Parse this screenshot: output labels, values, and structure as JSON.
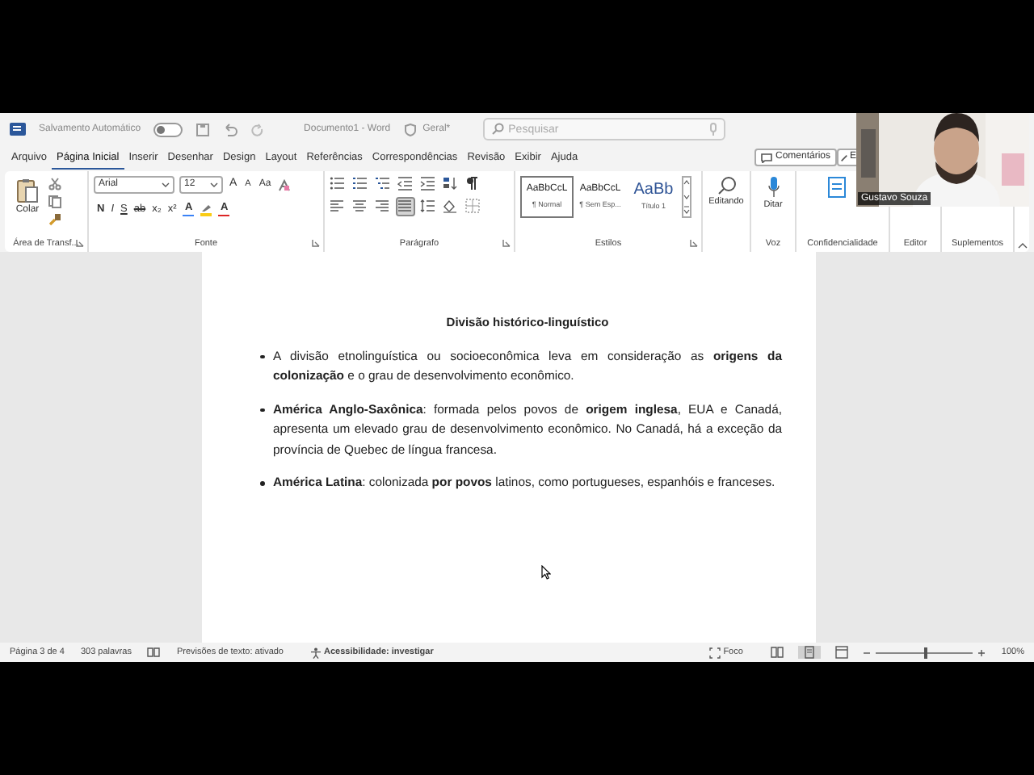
{
  "title_bar": {
    "autosave_label": "Salvamento Automático",
    "autosave_on": false,
    "document_title": "Documento1 - Word",
    "sensitivity": "Geral*",
    "search": {
      "placeholder": "Pesquisar"
    }
  },
  "menu_tabs": [
    {
      "label": "Arquivo",
      "selected": false
    },
    {
      "label": "Página Inicial",
      "selected": true
    },
    {
      "label": "Inserir",
      "selected": false
    },
    {
      "label": "Desenhar",
      "selected": false
    },
    {
      "label": "Design",
      "selected": false
    },
    {
      "label": "Layout",
      "selected": false
    },
    {
      "label": "Referências",
      "selected": false
    },
    {
      "label": "Correspondências",
      "selected": false
    },
    {
      "label": "Revisão",
      "selected": false
    },
    {
      "label": "Exibir",
      "selected": false
    },
    {
      "label": "Ajuda",
      "selected": false
    }
  ],
  "comments_button": "Comentários",
  "editing_button": "E",
  "ribbon": {
    "clipboard": {
      "paste": "Colar",
      "label": "Área de Transf..."
    },
    "font": {
      "name": "Arial",
      "size": "12",
      "label": "Fonte",
      "top_tools": [
        {
          "kind": "grow",
          "text": "A"
        },
        {
          "kind": "shrink",
          "text": "A"
        },
        {
          "kind": "case",
          "text": "Aa"
        }
      ],
      "format_tools": [
        {
          "kind": "bold",
          "text": "N"
        },
        {
          "kind": "italic",
          "text": "I"
        },
        {
          "kind": "underline",
          "text": "S"
        },
        {
          "kind": "strike",
          "text": "ab"
        },
        {
          "kind": "sub",
          "text": "x₂"
        },
        {
          "kind": "sup",
          "text": "x²"
        }
      ],
      "color_tools": [
        {
          "kind": "effects",
          "text": "A",
          "color": "#3b82f6"
        },
        {
          "kind": "highlight",
          "color": "#facc15"
        },
        {
          "kind": "font_color",
          "text": "A",
          "color": "#dc2626"
        }
      ]
    },
    "paragraph": {
      "label": "Parágrafo",
      "row_1": [
        {
          "kind": "bullets",
          "selected": false
        },
        {
          "kind": "numbering",
          "selected": false
        },
        {
          "kind": "multilevel",
          "selected": false
        },
        {
          "kind": "outdent",
          "selected": false
        },
        {
          "kind": "indent",
          "selected": false
        },
        {
          "kind": "sort",
          "selected": false
        },
        {
          "kind": "marks",
          "selected": false
        }
      ],
      "row_2": [
        {
          "kind": "left",
          "selected": false
        },
        {
          "kind": "center",
          "selected": false
        },
        {
          "kind": "right",
          "selected": false
        },
        {
          "kind": "justify",
          "selected": true
        },
        {
          "kind": "spacing",
          "selected": false
        },
        {
          "kind": "shading",
          "selected": false
        },
        {
          "kind": "borders",
          "selected": false
        }
      ]
    },
    "styles": {
      "label": "Estilos",
      "items": [
        {
          "preview": "AaBbCcL",
          "name": "¶ Normal",
          "selected": true,
          "kind": "normal"
        },
        {
          "preview": "AaBbCcL",
          "name": "¶ Sem Esp...",
          "selected": false,
          "kind": "normal"
        },
        {
          "preview": "AaBb",
          "name": "Título 1",
          "selected": false,
          "kind": "heading"
        }
      ]
    },
    "editing": {
      "label": "Editando"
    },
    "voice": {
      "button": "Ditar",
      "label": "Voz"
    },
    "groups_right": [
      "Confidencialidade",
      "Editor",
      "Suplementos"
    ]
  },
  "webcam": {
    "name": "Gustavo Souza"
  },
  "document": {
    "heading": "Divisão histórico-linguístico",
    "bullets": [
      "A divisão etnolinguística ou socioeconômica leva em consideração as **origens da colonização** e o grau de desenvolvimento econômico.",
      "**América Anglo-Saxônica**: formada pelos povos de **origem inglesa**, EUA e Canadá, apresenta um elevado grau de desenvolvimento econômico. No Canadá, há a exceção da província de Quebec de língua francesa.",
      "**América Latina**: colonizada **por povos** latinos, como portugueses, espanhóis e franceses."
    ]
  },
  "status_bar": {
    "page": "Página 3 de 4",
    "words": "303 palavras",
    "predictions": "Previsões de texto: ativado",
    "accessibility": "Acessibilidade: investigar",
    "focus": "Foco",
    "views": [
      {
        "kind": "read",
        "selected": false
      },
      {
        "kind": "print",
        "selected": true
      },
      {
        "kind": "web",
        "selected": false
      }
    ],
    "zoom": {
      "level": 0.5,
      "reading": "100%"
    }
  }
}
